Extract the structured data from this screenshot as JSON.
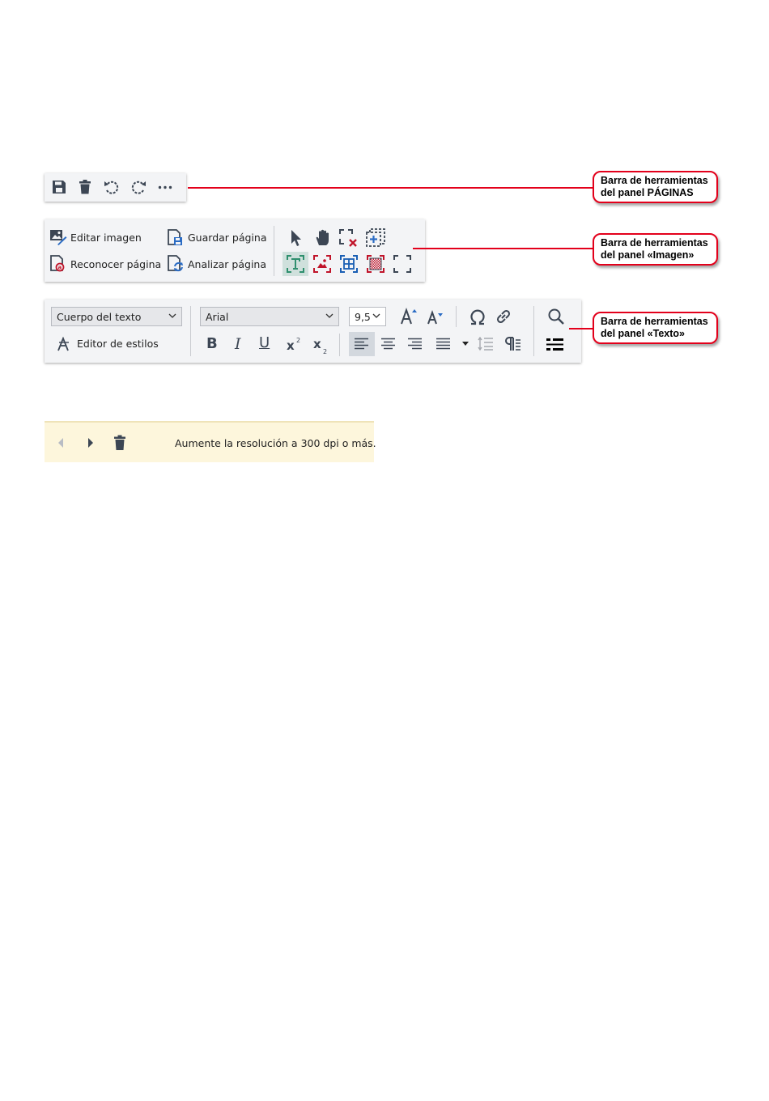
{
  "pages_toolbar": {
    "icons": [
      "save-icon",
      "delete-icon",
      "undo-icon",
      "redo-icon",
      "more-icon"
    ]
  },
  "image_toolbar": {
    "edit_image": "Editar imagen",
    "recognize_page": "Reconocer página",
    "save_page": "Guardar página",
    "analyze_page": "Analizar página",
    "tools": [
      "pointer-icon",
      "hand-icon",
      "delete-area-icon",
      "add-area-icon",
      "text-area-icon",
      "picture-area-icon",
      "table-area-icon",
      "background-picture-area-icon",
      "recognition-area-icon"
    ]
  },
  "text_toolbar": {
    "style_value": "Cuerpo del texto",
    "font_value": "Arial",
    "size_value": "9,5",
    "style_editor": "Editor de estilos"
  },
  "callouts": {
    "pages": "Barra de herramientas del panel PÁGINAS",
    "image": "Barra de herramientas del panel «Imagen»",
    "text": "Barra de herramientas del panel «Texto»"
  },
  "warning_bar": {
    "message": "Aumente la resolución a 300 dpi o más."
  },
  "colors": {
    "callout_red": "#e3001b",
    "warning_bg": "#fdf6dc",
    "area_green": "#2f8f6e",
    "area_red": "#c0142a",
    "area_blue": "#1a5fb4"
  }
}
